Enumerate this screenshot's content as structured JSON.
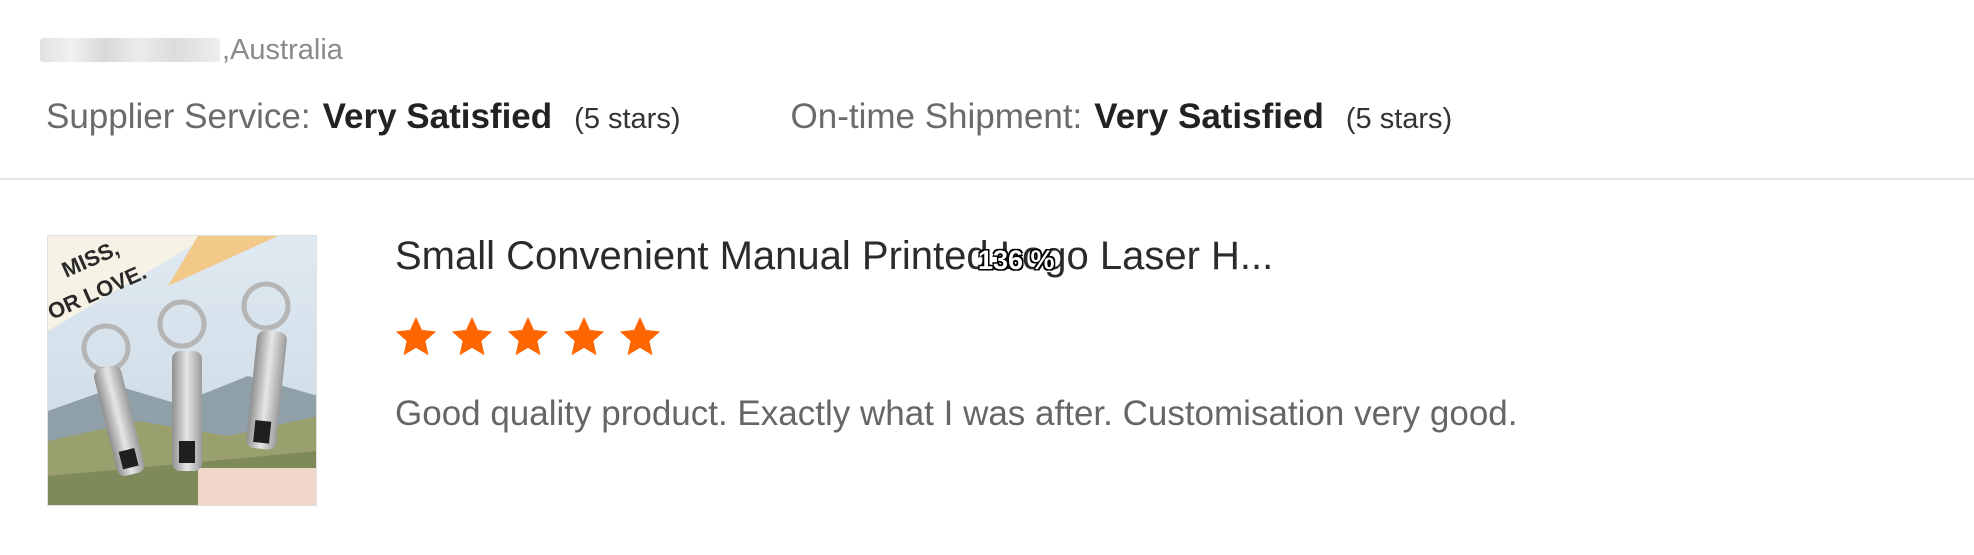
{
  "buyer": {
    "location": ",Australia"
  },
  "ratings": [
    {
      "label": "Supplier Service:",
      "value": "Very Satisfied",
      "stars": "(5 stars)"
    },
    {
      "label": "On-time Shipment:",
      "value": "Very Satisfied",
      "stars": "(5 stars)"
    }
  ],
  "review": {
    "title": "Small Convenient Manual Printed Logo Laser H...",
    "rating": 5,
    "text": "Good quality product. Exactly what I was after. Customisation very good.",
    "thumbnail_caption": [
      "MISS,",
      "OR LOVE."
    ]
  },
  "zoom_indicator": "136 %",
  "colors": {
    "star": "#ff6600",
    "divider": "#e3e3e3"
  }
}
